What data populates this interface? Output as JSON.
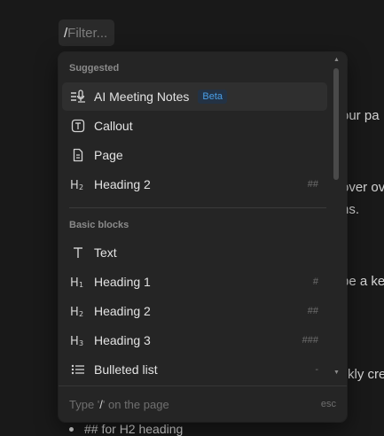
{
  "filter": {
    "slash": "/",
    "placeholder": "Filter..."
  },
  "background_fragments": [
    "our pa",
    "over ov",
    "ns.",
    "be a ke",
    "kly cre"
  ],
  "background_bullet": "## for H2 heading",
  "menu": {
    "suggested_label": "Suggested",
    "suggested": [
      {
        "icon": "meeting-notes-icon",
        "label": "AI Meeting Notes",
        "badge": "Beta",
        "shortcut": ""
      },
      {
        "icon": "callout-icon",
        "label": "Callout",
        "shortcut": ""
      },
      {
        "icon": "page-icon",
        "label": "Page",
        "shortcut": ""
      },
      {
        "icon": "heading2-icon",
        "label": "Heading 2",
        "shortcut": "##"
      }
    ],
    "basic_label": "Basic blocks",
    "basic": [
      {
        "icon": "text-icon",
        "label": "Text",
        "shortcut": ""
      },
      {
        "icon": "heading1-icon",
        "label": "Heading 1",
        "shortcut": "#"
      },
      {
        "icon": "heading2-icon",
        "label": "Heading 2",
        "shortcut": "##"
      },
      {
        "icon": "heading3-icon",
        "label": "Heading 3",
        "shortcut": "###"
      },
      {
        "icon": "bulleted-list-icon",
        "label": "Bulleted list",
        "shortcut": "-"
      }
    ],
    "footer": {
      "prefix": "Type '",
      "slash": "/",
      "suffix": "' on the page",
      "esc": "esc"
    }
  },
  "colors": {
    "background": "#191919",
    "menu": "#252525",
    "accent": "#4a9fe6"
  }
}
